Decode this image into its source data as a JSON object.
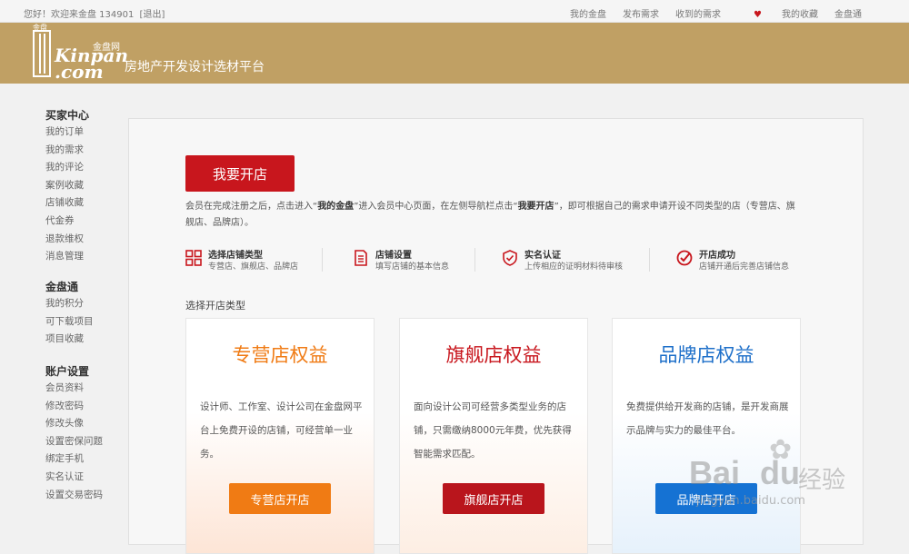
{
  "topbar": {
    "greeting": "您好！欢迎来金盘 134901",
    "logout": "[退出]",
    "links": [
      "我的金盘",
      "发布需求",
      "收到的需求",
      "我的收藏",
      "金盘通"
    ]
  },
  "header": {
    "logo_cn_small": "金盘",
    "logo_cn_net": "金盘网",
    "logo_word1": "Kinpan",
    "logo_word2": ".com",
    "slogan": "房地产开发设计选材平台"
  },
  "sidebar": {
    "groups": [
      {
        "title": "买家中心",
        "items": [
          "我的订单",
          "我的需求",
          "我的评论",
          "案例收藏",
          "店铺收藏",
          "代金券",
          "退款维权",
          "消息管理"
        ]
      },
      {
        "title": "金盘通",
        "items": [
          "我的积分",
          "可下载项目",
          "项目收藏"
        ]
      },
      {
        "title": "账户设置",
        "items": [
          "会员资料",
          "修改密码",
          "修改头像",
          "设置密保问题",
          "绑定手机",
          "实名认证",
          "设置交易密码"
        ]
      }
    ]
  },
  "main": {
    "open_button": "我要开店",
    "desc_part1": "会员在完成注册之后，点击进入“",
    "desc_bold1": "我的金盘",
    "desc_part2": "”进入会员中心页面，在左侧导航栏点击“",
    "desc_bold2": "我要开店",
    "desc_part3": "”，即可根据自己的需求申请开设不同类型的店（专营店、旗舰店、品牌店）。",
    "steps": [
      {
        "title": "选择店铺类型",
        "sub": "专营店、旗舰店、品牌店",
        "icon": "grid-icon"
      },
      {
        "title": "店铺设置",
        "sub": "填写店铺的基本信息",
        "icon": "document-icon"
      },
      {
        "title": "实名认证",
        "sub": "上传相应的证明材料待审核",
        "icon": "shield-check-icon"
      },
      {
        "title": "开店成功",
        "sub": "店铺开通后完善店铺信息",
        "icon": "check-circle-icon"
      }
    ],
    "select_title": "选择开店类型",
    "cards": [
      {
        "title": "专营店权益",
        "desc": "设计师、工作室、设计公司在金盘网平台上免费开设的店铺，可经营单一业务。",
        "button": "专营店开店"
      },
      {
        "title": "旗舰店权益",
        "desc": "面向设计公司可经营多类型业务的店铺，只需缴纳8000元年费，优先获得智能需求匹配。",
        "button": "旗舰店开店"
      },
      {
        "title": "品牌店权益",
        "desc": "免费提供给开发商的店铺，是开发商展示品牌与实力的最佳平台。",
        "button": "品牌店开店"
      }
    ]
  },
  "watermark": {
    "brand": "Bai",
    "brand2": "du",
    "cn": "经验",
    "url": "jingyan.baidu.com"
  },
  "colors": {
    "header_bg": "#c0a064",
    "brand_red": "#c8161d",
    "orange": "#f07b14",
    "blue": "#1572d3"
  }
}
